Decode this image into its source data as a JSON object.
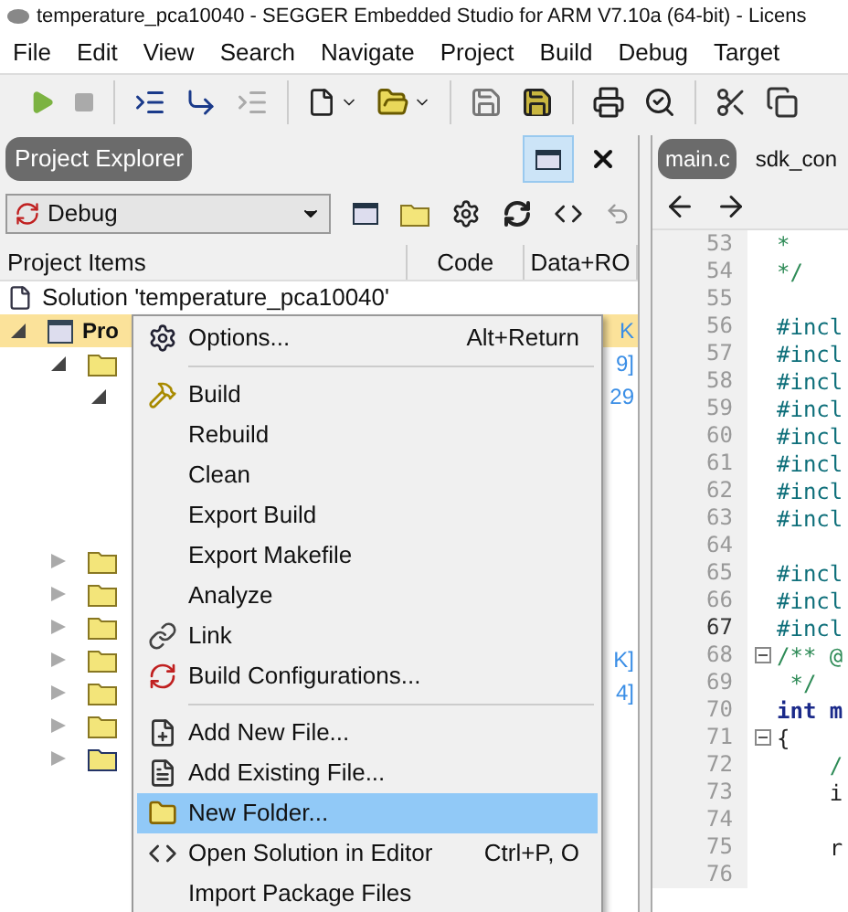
{
  "window": {
    "title": "temperature_pca10040 - SEGGER Embedded Studio for ARM V7.10a (64-bit) - Licens"
  },
  "menu_bar": [
    "File",
    "Edit",
    "View",
    "Search",
    "Navigate",
    "Project",
    "Build",
    "Debug",
    "Target"
  ],
  "project_explorer": {
    "title": "Project Explorer",
    "configuration": "Debug",
    "columns": [
      "Project Items",
      "Code",
      "Data+RO"
    ],
    "tree": [
      {
        "label": "Solution 'temperature_pca10040'",
        "kind": "solution",
        "selected": false,
        "children": [
          {
            "label": "Pro",
            "kind": "project",
            "expanded": true,
            "selected": true,
            "data": "K",
            "children": [
              {
                "kind": "folder",
                "expanded": true,
                "selected": false,
                "data": "9]",
                "children": [
                  {
                    "expanded": true,
                    "selected": false,
                    "data": "29"
                  }
                ]
              },
              {
                "kind": "folder",
                "expanded": false,
                "selected": false
              },
              {
                "kind": "folder",
                "expanded": false,
                "selected": false
              },
              {
                "kind": "folder",
                "expanded": false,
                "selected": false
              },
              {
                "kind": "folder",
                "expanded": false,
                "selected": false,
                "data": "K]"
              },
              {
                "kind": "folder",
                "expanded": false,
                "selected": false,
                "data": "4]"
              },
              {
                "kind": "folder",
                "expanded": false,
                "selected": false
              },
              {
                "kind": "linked-folder",
                "expanded": false,
                "selected": false
              }
            ]
          }
        ]
      }
    ]
  },
  "context_menu": [
    [
      {
        "label": "Options...",
        "shortcut": "Alt+Return",
        "selected": false
      }
    ],
    [
      {
        "label": "Build",
        "selected": false
      },
      {
        "label": "Rebuild",
        "selected": false
      },
      {
        "label": "Clean",
        "selected": false
      },
      {
        "label": "Export Build",
        "selected": false
      },
      {
        "label": "Export Makefile",
        "selected": false
      },
      {
        "label": "Analyze",
        "selected": false
      },
      {
        "label": "Link",
        "selected": false
      },
      {
        "label": "Build Configurations...",
        "selected": false
      }
    ],
    [
      {
        "label": "Add New File...",
        "selected": false
      },
      {
        "label": "Add Existing File...",
        "selected": false
      },
      {
        "label": "New Folder...",
        "selected": true
      },
      {
        "label": "Open Solution in Editor",
        "shortcut": "Ctrl+P, O",
        "selected": false
      },
      {
        "label": "Import Package Files",
        "selected": false
      }
    ]
  ],
  "editor": {
    "tabs": [
      {
        "label": "main.c",
        "selected": true
      },
      {
        "label": "sdk_con",
        "selected": false
      }
    ],
    "lines": [
      {
        "number": "53",
        "text": "*",
        "kind": "comment"
      },
      {
        "number": "54",
        "text": "*/",
        "kind": "comment"
      },
      {
        "number": "55"
      },
      {
        "number": "56",
        "text": "#incl",
        "kind": "directive"
      },
      {
        "number": "57",
        "text": "#incl",
        "kind": "directive"
      },
      {
        "number": "58",
        "text": "#incl",
        "kind": "directive"
      },
      {
        "number": "59",
        "text": "#incl",
        "kind": "directive"
      },
      {
        "number": "60",
        "text": "#incl",
        "kind": "directive"
      },
      {
        "number": "61",
        "text": "#incl",
        "kind": "directive"
      },
      {
        "number": "62",
        "text": "#incl",
        "kind": "directive"
      },
      {
        "number": "63",
        "text": "#incl",
        "kind": "directive"
      },
      {
        "number": "64"
      },
      {
        "number": "65",
        "text": "#incl",
        "kind": "directive"
      },
      {
        "number": "66",
        "text": "#incl",
        "kind": "directive"
      },
      {
        "number": "67",
        "text": "#incl",
        "kind": "directive",
        "current": true
      },
      {
        "number": "68",
        "text": "/** @",
        "kind": "comment",
        "fold": true
      },
      {
        "number": "69",
        "text": " */",
        "kind": "comment"
      },
      {
        "number": "70",
        "text": "int m",
        "kind": "keyword"
      },
      {
        "number": "71",
        "text": "{",
        "kind": "plain",
        "fold": true
      },
      {
        "number": "72",
        "text": "    /",
        "kind": "comment"
      },
      {
        "number": "73",
        "text": "    i",
        "kind": "plain"
      },
      {
        "number": "74"
      },
      {
        "number": "75",
        "text": "    r",
        "kind": "plain"
      },
      {
        "number": "76"
      }
    ]
  }
}
